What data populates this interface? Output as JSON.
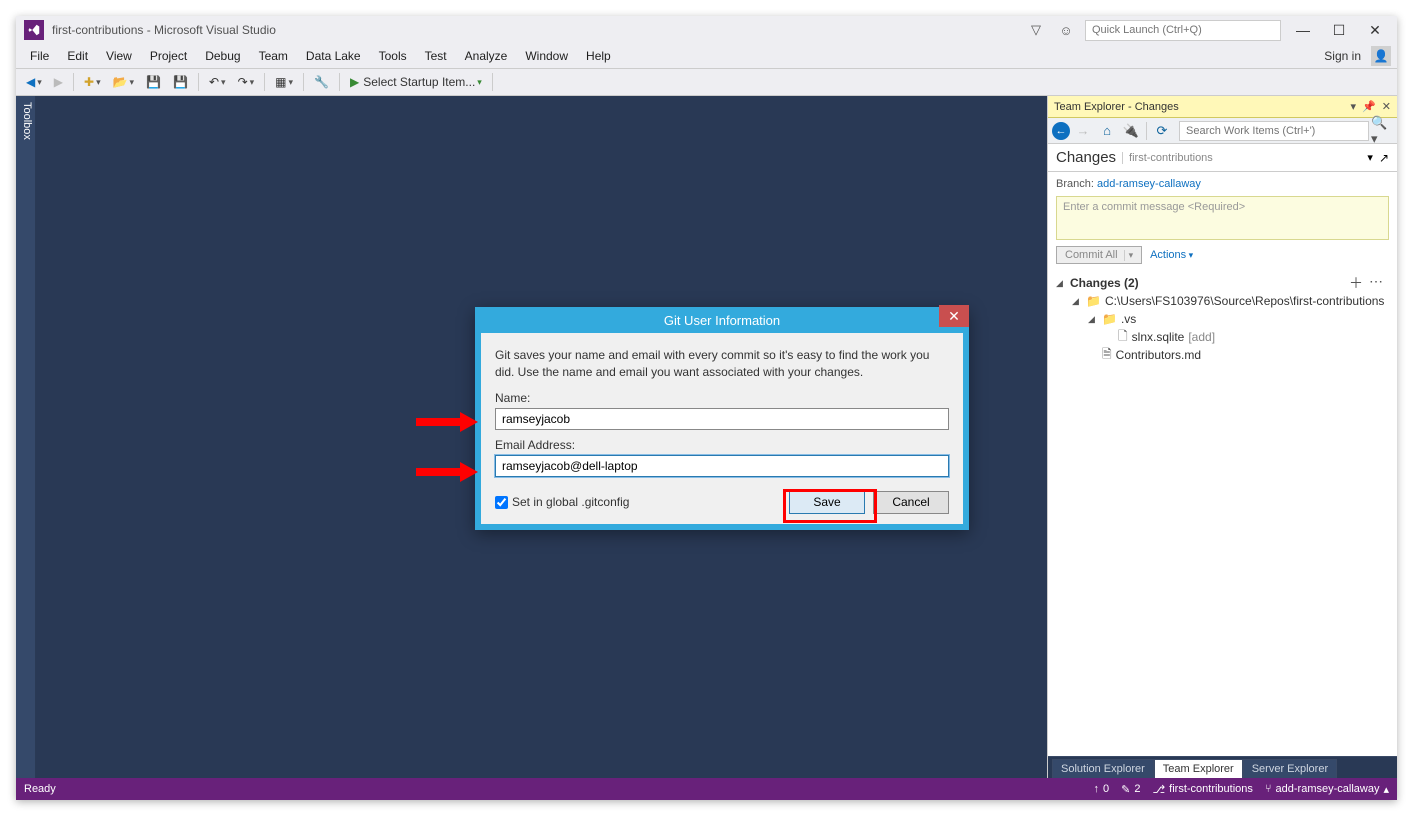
{
  "titlebar": {
    "title": "first-contributions - Microsoft Visual Studio",
    "quicklaunch_placeholder": "Quick Launch (Ctrl+Q)"
  },
  "menubar": {
    "items": [
      "File",
      "Edit",
      "View",
      "Project",
      "Debug",
      "Team",
      "Data Lake",
      "Tools",
      "Test",
      "Analyze",
      "Window",
      "Help"
    ],
    "signin": "Sign in"
  },
  "toolbar": {
    "startup": "Select Startup Item..."
  },
  "toolbox": {
    "label": "Toolbox"
  },
  "team_explorer": {
    "title": "Team Explorer - Changes",
    "search_placeholder": "Search Work Items (Ctrl+')",
    "header": "Changes",
    "project": "first-contributions",
    "branch_label": "Branch:",
    "branch_name": "add-ramsey-callaway",
    "commit_placeholder": "Enter a commit message <Required>",
    "commit_btn": "Commit All",
    "actions": "Actions",
    "changes_group": "Changes (2)",
    "tree": {
      "repo_path": "C:\\Users\\FS103976\\Source\\Repos\\first-contributions",
      "vs_folder": ".vs",
      "sqlite_file": "slnx.sqlite",
      "sqlite_tag": "[add]",
      "contributors": "Contributors.md"
    },
    "tabs": [
      "Solution Explorer",
      "Team Explorer",
      "Server Explorer"
    ]
  },
  "dialog": {
    "title": "Git User Information",
    "desc": "Git saves your name and email with every commit so it's easy to find the work you did. Use the name and email you want associated with your changes.",
    "name_label": "Name:",
    "name_value": "ramseyjacob",
    "email_label": "Email Address:",
    "email_value": "ramseyjacob@dell-laptop",
    "checkbox": "Set in global .gitconfig",
    "save": "Save",
    "cancel": "Cancel"
  },
  "statusbar": {
    "ready": "Ready",
    "up": "0",
    "pencil": "2",
    "repo": "first-contributions",
    "branch": "add-ramsey-callaway"
  }
}
